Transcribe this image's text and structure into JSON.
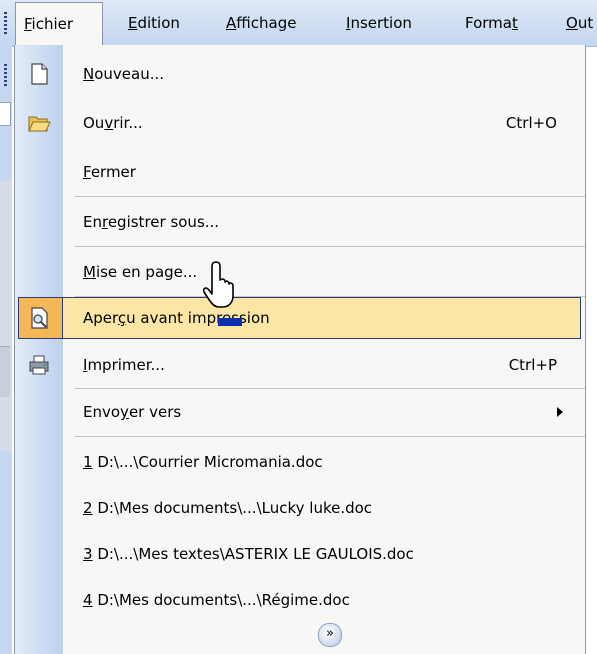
{
  "menubar": {
    "items": [
      {
        "label": "Fichier",
        "mnemonic": "F",
        "rest": "ichier"
      },
      {
        "label": "Edition",
        "mnemonic": "E",
        "rest": "dition"
      },
      {
        "label": "Affichage",
        "mnemonic": "A",
        "rest": "ffichage"
      },
      {
        "label": "Insertion",
        "mnemonic": "I",
        "rest": "nsertion"
      },
      {
        "label": "Format",
        "pre": "Forma",
        "mnemonic": "t"
      },
      {
        "label": "Out",
        "mnemonic": "O",
        "rest": "ut"
      }
    ]
  },
  "menu": {
    "nouveau": {
      "pre": "",
      "mn": "N",
      "post": "ouveau...",
      "icon": "new-document-icon"
    },
    "ouvrir": {
      "pre": "Ou",
      "mn": "v",
      "post": "rir...",
      "shortcut": "Ctrl+O",
      "icon": "open-folder-icon"
    },
    "fermer": {
      "pre": "",
      "mn": "F",
      "post": "ermer"
    },
    "enregistrer": {
      "pre": "En",
      "mn": "r",
      "post": "egistrer sous..."
    },
    "mise": {
      "pre": "",
      "mn": "M",
      "post": "ise en page..."
    },
    "apercu": {
      "pre": "Aper",
      "mn": "ç",
      "post": "u avant impression",
      "icon": "print-preview-icon"
    },
    "imprimer": {
      "pre": "",
      "mn": "I",
      "post": "mprimer...",
      "shortcut": "Ctrl+P",
      "icon": "printer-icon"
    },
    "envoyer": {
      "pre": "Envo",
      "mn": "y",
      "post": "er vers"
    },
    "recent": [
      {
        "mn": "1",
        "post": " D:\\...\\Courrier Micromania.doc"
      },
      {
        "mn": "2",
        "post": " D:\\Mes documents\\...\\Lucky luke.doc"
      },
      {
        "mn": "3",
        "post": " D:\\...\\Mes textes\\ASTERIX LE GAULOIS.doc"
      },
      {
        "mn": "4",
        "post": " D:\\Mes documents\\...\\Régime.doc"
      }
    ],
    "expand_icon": "chevron-double-down-icon"
  },
  "colors": {
    "highlight": "#fbe6a6",
    "highlight_border": "#2a3f78",
    "icon_box": "#f5b657"
  }
}
